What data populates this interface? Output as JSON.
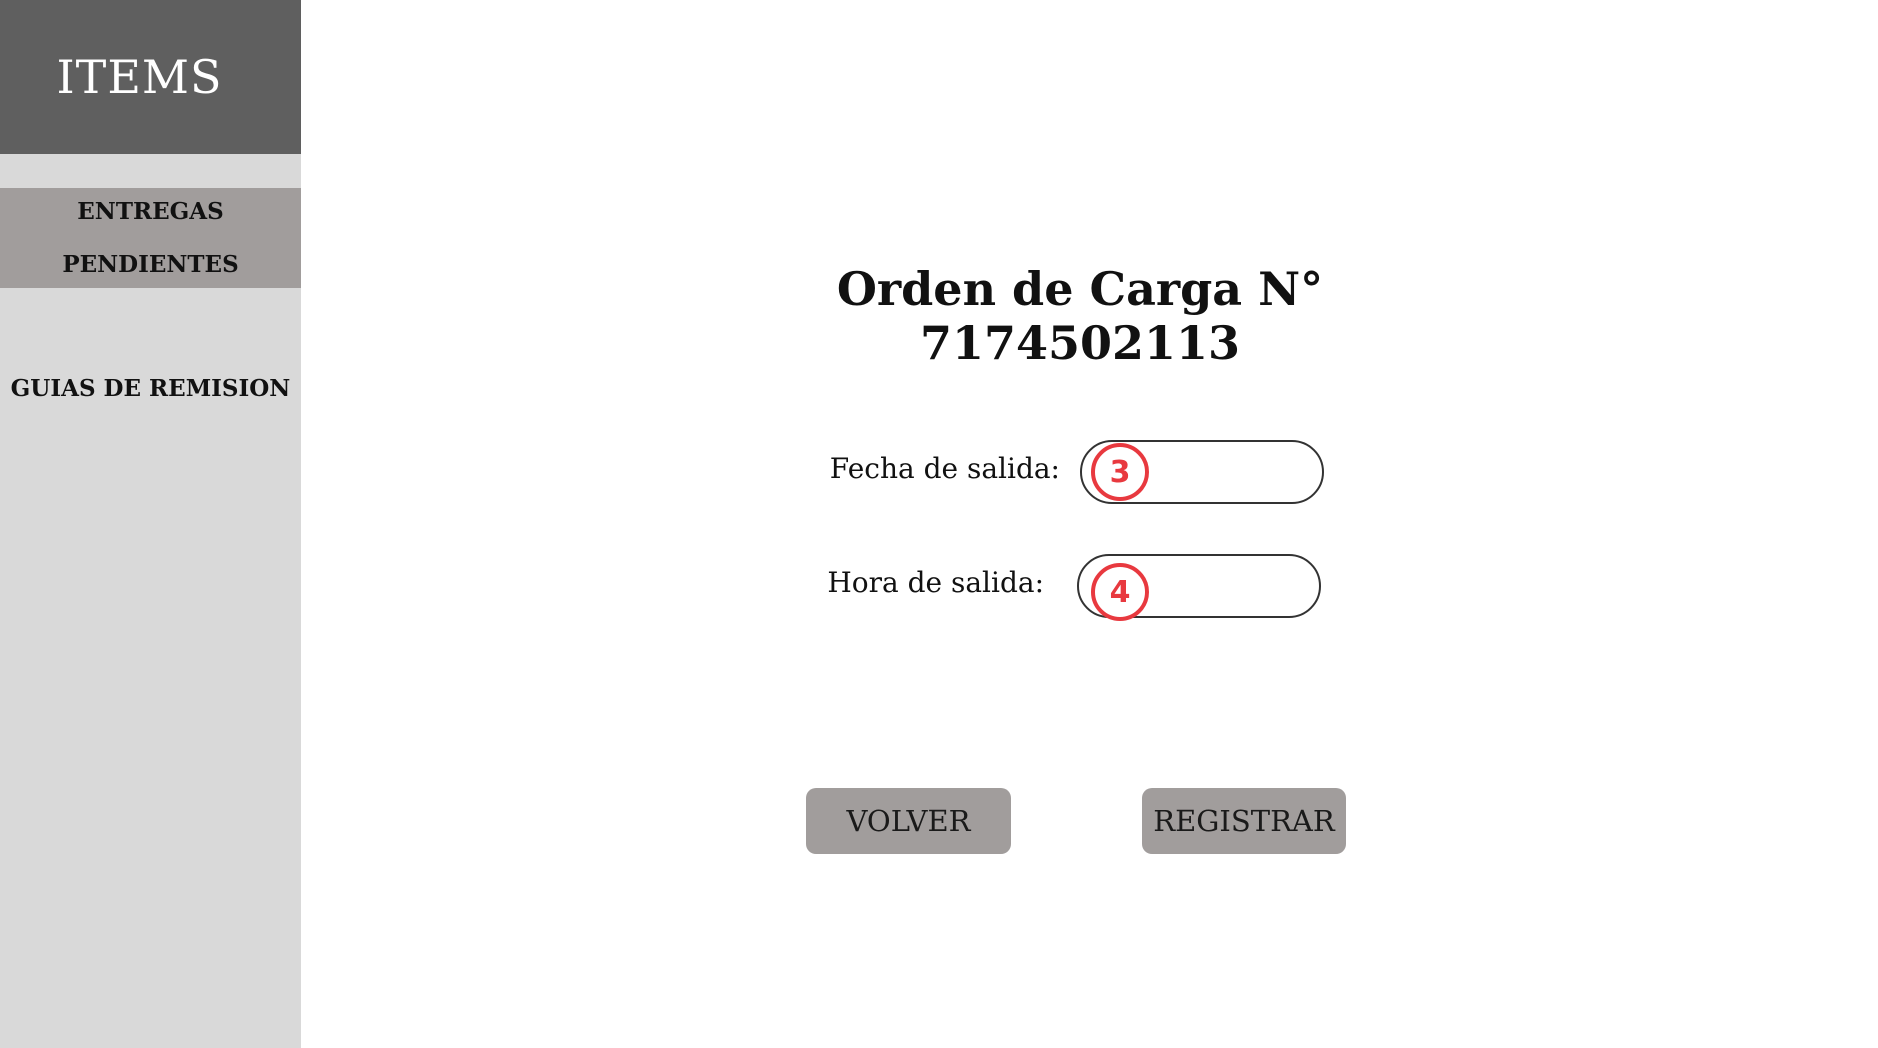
{
  "sidebar": {
    "brand": "ITEMS",
    "items": [
      {
        "line1": "ENTREGAS",
        "line2": "PENDIENTES"
      },
      {
        "label": "GUIAS DE REMISION"
      }
    ]
  },
  "main": {
    "title": "Orden de Carga N° 7174502113",
    "fields": {
      "fecha_label": "Fecha de salida:",
      "fecha_value": "",
      "hora_label": "Hora de salida:",
      "hora_value": ""
    },
    "markers": [
      "3",
      "4"
    ],
    "buttons": {
      "volver": "VOLVER",
      "registrar": "REGISTRAR"
    }
  },
  "colors": {
    "brand_bg": "#5f5f5f",
    "sidebar_bg": "#d9d9d9",
    "active_item_bg": "#a19d9c",
    "button_bg": "#a19d9c",
    "marker": "#e8393f"
  }
}
